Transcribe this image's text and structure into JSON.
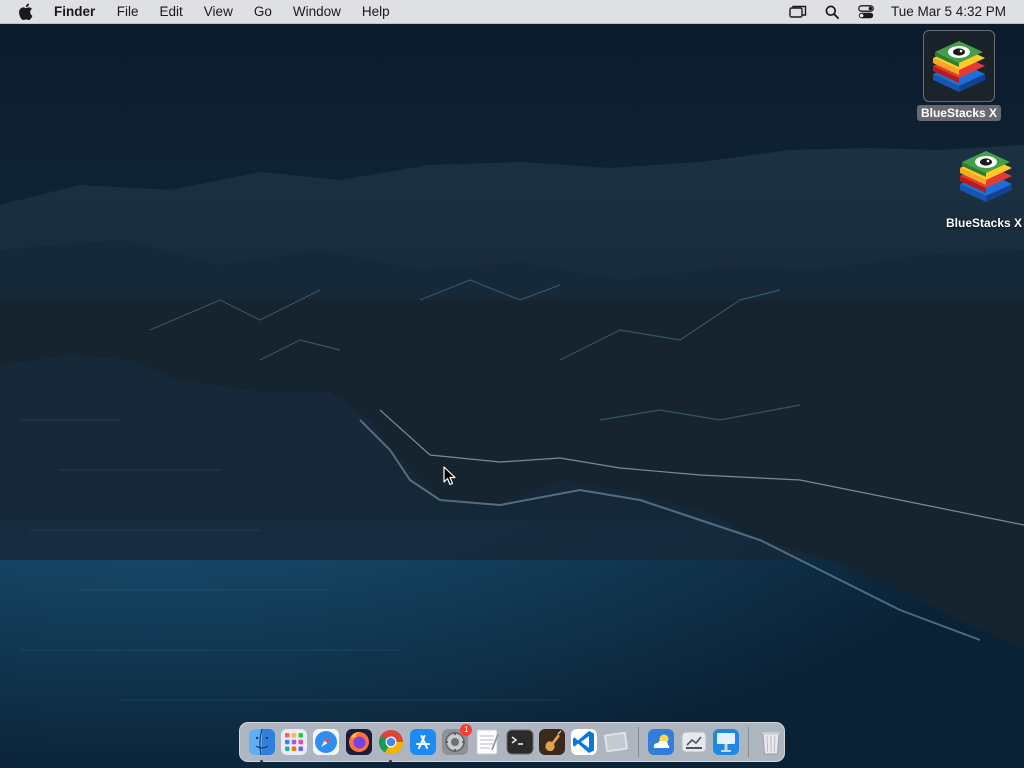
{
  "menubar": {
    "app_name": "Finder",
    "items": [
      "File",
      "Edit",
      "View",
      "Go",
      "Window",
      "Help"
    ],
    "clock": "Tue Mar 5  4:32 PM",
    "status_icons": [
      "screen-mirroring-icon",
      "spotlight-search-icon",
      "control-center-icon"
    ]
  },
  "desktop": {
    "icons": [
      {
        "label": "BlueStacks X",
        "icon": "bluestacks-icon",
        "selected": true
      },
      {
        "label": "BlueStacks X",
        "icon": "bluestacks-icon",
        "selected": false
      }
    ]
  },
  "dock": {
    "apps": [
      {
        "name": "finder",
        "running": true
      },
      {
        "name": "launchpad",
        "running": false
      },
      {
        "name": "safari",
        "running": false
      },
      {
        "name": "firefox",
        "running": false
      },
      {
        "name": "chrome",
        "running": true
      },
      {
        "name": "app-store",
        "running": false
      },
      {
        "name": "system-preferences",
        "running": false,
        "badge": "1"
      },
      {
        "name": "textedit",
        "running": false
      },
      {
        "name": "terminal",
        "running": false
      },
      {
        "name": "garageband",
        "running": false
      },
      {
        "name": "vscode",
        "running": false
      },
      {
        "name": "preview",
        "running": false
      },
      {
        "name": "weather",
        "running": false
      },
      {
        "name": "file-transfer",
        "running": false
      },
      {
        "name": "keynote",
        "running": false
      },
      {
        "name": "trash",
        "running": false
      }
    ]
  },
  "colors": {
    "menubar_bg": "#e8e8ec",
    "selection_label": "#6e6e73",
    "water": "#123a56",
    "sky": "#0c1e30"
  }
}
